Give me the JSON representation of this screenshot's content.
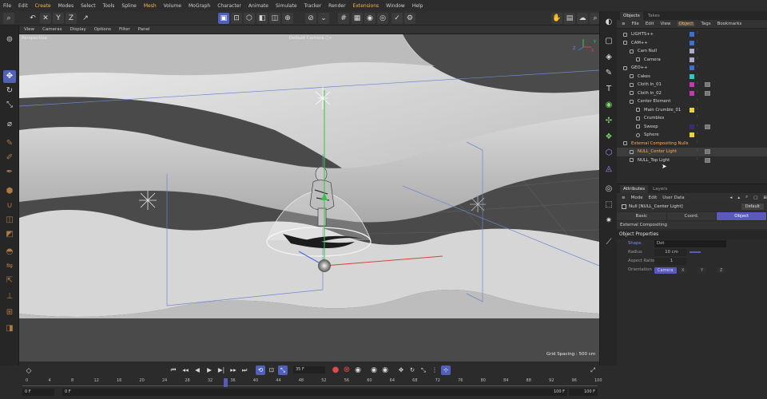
{
  "menubar": [
    "File",
    "Edit",
    "Create",
    "Modes",
    "Select",
    "Tools",
    "Spline",
    "Mesh",
    "Volume",
    "MoGraph",
    "Character",
    "Animate",
    "Simulate",
    "Tracker",
    "Render",
    "Extensions",
    "Window",
    "Help"
  ],
  "viewport": {
    "menu": [
      "View",
      "Cameras",
      "Display",
      "Options",
      "Filter",
      "Panel"
    ],
    "name": "Perspective",
    "camera": "Default Camera ○•",
    "grid_spacing": "Grid Spacing : 500 cm",
    "axis_x": "X",
    "axis_y": "Y",
    "axis_z": "Z"
  },
  "objects_panel": {
    "tabs": [
      "Objects",
      "Takes"
    ],
    "menu": [
      "File",
      "Edit",
      "View",
      "Object",
      "Tags",
      "Bookmarks"
    ],
    "rows": [
      {
        "name": "LIGHTS++",
        "color": "#3a6fd6"
      },
      {
        "name": "CAM++",
        "color": "#3a6fd6"
      },
      {
        "name": "Cam Null",
        "color": "#b0a8c8"
      },
      {
        "name": "Camera",
        "color": "#b0a8c8"
      },
      {
        "name": "GEO++",
        "color": "#3a6fd6"
      },
      {
        "name": "Cakes",
        "color": "#2ec7c7"
      },
      {
        "name": "Cloth In_01",
        "color": "#d033b5"
      },
      {
        "name": "Cloth In_02",
        "color": "#d033b5"
      },
      {
        "name": "Center Element",
        "color": "#aaaaaa"
      },
      {
        "name": "Main Crumble_01",
        "color": "#e8d53a"
      },
      {
        "name": "Crumbles",
        "color": "#aaaaaa"
      },
      {
        "name": "Sweep",
        "color": "#3d2a80"
      },
      {
        "name": "Sphere",
        "color": "#e8d53a"
      },
      {
        "name": "External Compositing Nulls",
        "color": "#aaaaaa"
      },
      {
        "name": "NULL_Center Light",
        "color": "#aaaaaa"
      },
      {
        "name": "NULL_Top Light",
        "color": "#aaaaaa"
      }
    ]
  },
  "attributes_panel": {
    "tabs": [
      "Attributes",
      "Layers"
    ],
    "menu": [
      "Mode",
      "Edit",
      "User Data"
    ],
    "object_name": "Null [NULL_Center Light]",
    "default_label": "Default",
    "subtabs": [
      "Basic",
      "Coord.",
      "Object"
    ],
    "ext_comp": "External Compositing",
    "section": "Object Properties",
    "props": {
      "shape_label": "Shape",
      "shape_value": "Dot",
      "radius_label": "Radius",
      "radius_value": "10 cm",
      "aspect_label": "Aspect Ratio",
      "aspect_value": "1",
      "orient_label": "Orientation",
      "orient_options": [
        "Camera",
        "X",
        "Y",
        "Z"
      ]
    }
  },
  "timeline": {
    "current_frame": "35 F",
    "start_left": "0 F",
    "start_right": "0 F",
    "end_left": "100 F",
    "end_right": "100 F",
    "ticks": [
      "0",
      "4",
      "8",
      "12",
      "16",
      "20",
      "24",
      "28",
      "32",
      "36",
      "40",
      "44",
      "48",
      "52",
      "56",
      "60",
      "64",
      "68",
      "72",
      "76",
      "80",
      "84",
      "88",
      "92",
      "96",
      "100"
    ]
  },
  "colors": {
    "accent": "#5160b8",
    "highlight": "#ffb74a"
  }
}
